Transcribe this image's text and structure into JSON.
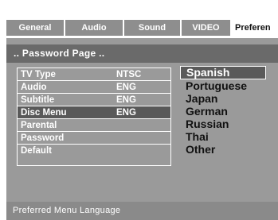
{
  "tabs": [
    {
      "label": "General"
    },
    {
      "label": "Audio"
    },
    {
      "label": "Sound"
    },
    {
      "label": "VIDEO"
    },
    {
      "label": "Preferen"
    }
  ],
  "page_title": ".. Password Page ..",
  "settings": [
    {
      "label": "TV Type",
      "value": "NTSC"
    },
    {
      "label": "Audio",
      "value": "ENG"
    },
    {
      "label": "Subtitle",
      "value": "ENG"
    },
    {
      "label": "Disc Menu",
      "value": "ENG"
    },
    {
      "label": "Parental",
      "value": ""
    },
    {
      "label": "Password",
      "value": ""
    },
    {
      "label": "Default",
      "value": ""
    }
  ],
  "options": [
    {
      "label": "Spanish"
    },
    {
      "label": "Portuguese"
    },
    {
      "label": "Japan"
    },
    {
      "label": "German"
    },
    {
      "label": "Russian"
    },
    {
      "label": "Thai"
    },
    {
      "label": "Other"
    }
  ],
  "footer_text": "Preferred  Menu Language",
  "colors": {
    "tab_bg": "#8e8e8e",
    "active_tab_bg": "#ffffff",
    "panel_bg": "#9a9a9a",
    "title_bar_bg": "#6a6a6a",
    "selected_row_bg": "#595959",
    "highlight_option_bg": "#5a5a5a",
    "footer_bg": "#8a8a8a"
  },
  "icons": {
    "scroll_down": "triangle-down-outline-icon"
  }
}
